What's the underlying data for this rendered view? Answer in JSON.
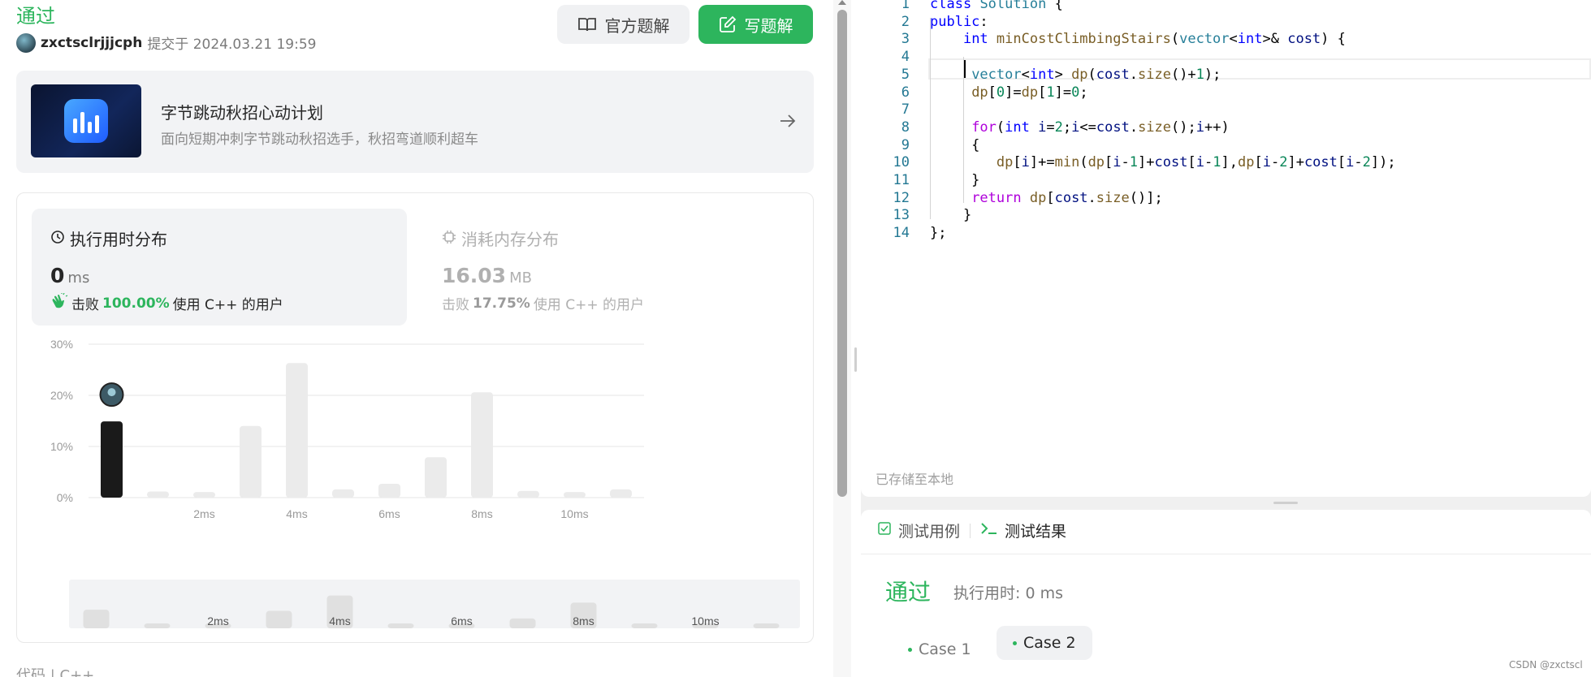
{
  "submission": {
    "status": "通过",
    "user": "zxctsclrjjjcph",
    "submitted_at": "提交于 2024.03.21 19:59",
    "official_solution_label": "官方题解",
    "write_solution_label": "写题解"
  },
  "banner": {
    "title": "字节跳动秋招心动计划",
    "subtitle": "面向短期冲刺字节跳动秋招选手，秋招弯道顺利超车"
  },
  "runtime": {
    "title": "执行用时分布",
    "value": "0",
    "unit": "ms",
    "beat_prefix": "击败",
    "beat_pct": "100.00%",
    "beat_suffix": "使用 C++ 的用户"
  },
  "memory": {
    "title": "消耗内存分布",
    "value": "16.03",
    "unit": "MB",
    "beat_prefix": "击败",
    "beat_pct": "17.75%",
    "beat_suffix": "使用 C++ 的用户"
  },
  "code_section_label": "代码 | C++",
  "chart_data": {
    "type": "bar",
    "title": "",
    "xlabel": "",
    "ylabel": "",
    "ylim": [
      0,
      30
    ],
    "y_ticks": [
      "30%",
      "20%",
      "10%",
      "0%"
    ],
    "x_ticks": [
      {
        "label": "2ms",
        "at": 2
      },
      {
        "label": "4ms",
        "at": 4
      },
      {
        "label": "6ms",
        "at": 6
      },
      {
        "label": "8ms",
        "at": 8
      },
      {
        "label": "10ms",
        "at": 10
      }
    ],
    "values": [
      14.9,
      1.2,
      1.1,
      14.0,
      26.3,
      1.6,
      2.7,
      7.9,
      20.6,
      1.3,
      1.1,
      1.6
    ],
    "highlighted_index": 0,
    "grid": true,
    "colors": {
      "highlight": "#1a1a1a",
      "normal": "#ebebeb"
    }
  },
  "editor": {
    "lines": [
      "class Solution {",
      "public:",
      "    int minCostClimbingStairs(vector<int>& cost) {",
      "    ",
      "     vector<int> dp(cost.size()+1);",
      "     dp[0]=dp[1]=0;",
      "",
      "     for(int i=2;i<=cost.size();i++)",
      "     {",
      "        dp[i]+=min(dp[i-1]+cost[i-1],dp[i-2]+cost[i-2]);",
      "     }",
      "     return dp[cost.size()];",
      "    }",
      "};"
    ],
    "saved_label": "已存储至本地"
  },
  "results": {
    "tab_cases": "测试用例",
    "tab_results": "测试结果",
    "status": "通过",
    "runtime": "执行用时: 0 ms",
    "case1": "Case 1",
    "case2": "Case 2"
  },
  "watermark": "CSDN @zxctscl",
  "colors": {
    "accent": "#2db55d"
  }
}
